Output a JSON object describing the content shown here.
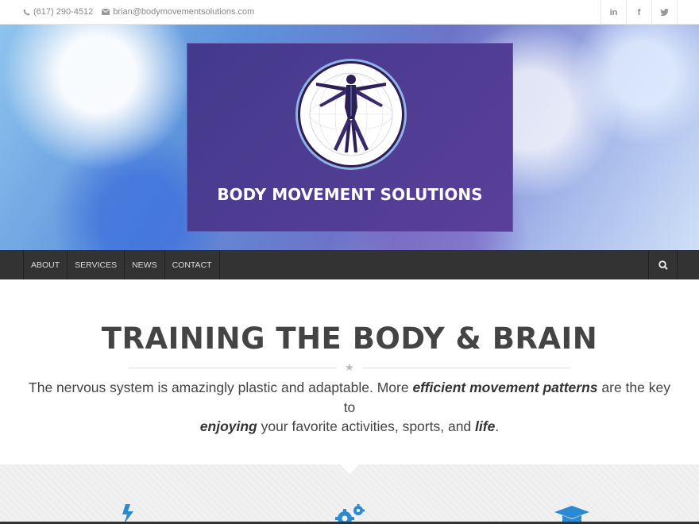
{
  "topbar": {
    "phone": "(617) 290-4512",
    "email": "brian@bodymovementsolutions.com",
    "phone_icon": "phone-icon",
    "email_icon": "envelope-icon",
    "social": [
      {
        "icon": "linkedin-icon",
        "glyph": "in"
      },
      {
        "icon": "facebook-icon",
        "glyph": "f"
      },
      {
        "icon": "twitter-icon",
        "glyph": "t"
      }
    ]
  },
  "hero": {
    "logo_title": "BODY MOVEMENT SOLUTIONS",
    "logo_icon": "vitruvian-man-logo"
  },
  "nav": {
    "items": [
      "ABOUT",
      "SERVICES",
      "NEWS",
      "CONTACT"
    ],
    "search_icon": "search-icon"
  },
  "main": {
    "headline": "TRAINING THE BODY & BRAIN",
    "intro_part1": "The nervous system is amazingly plastic and adaptable. More ",
    "intro_em1": "efficient movement patterns",
    "intro_part2": " are the key to ",
    "intro_em2": "enjoying",
    "intro_part3": " your favorite activities, sports, and ",
    "intro_em3": "life",
    "intro_part4": "."
  },
  "features": {
    "icons": [
      "lightning-icon",
      "gears-icon",
      "graduation-cap-icon"
    ]
  },
  "colors": {
    "accent": "#2b8ad1",
    "nav_bg": "#333333",
    "logo_box": "#4d3d8f"
  }
}
